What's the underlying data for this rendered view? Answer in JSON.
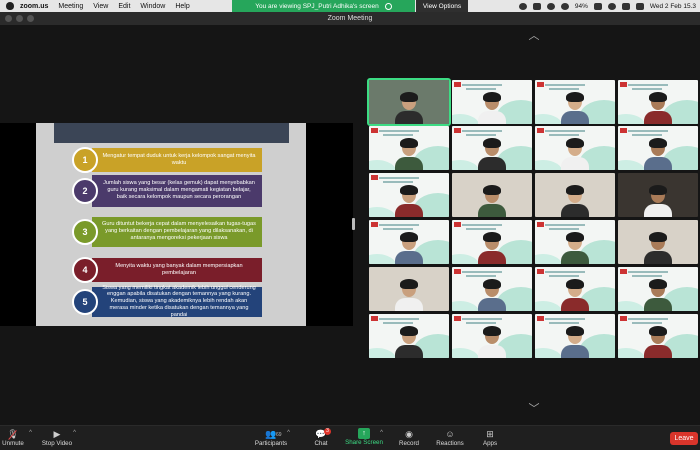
{
  "menubar": {
    "app": "zoom.us",
    "items": [
      "Meeting",
      "View",
      "Edit",
      "Window",
      "Help"
    ],
    "share_banner": "You are viewing SPJ_Putri Adhika's screen",
    "view_options": "View Options",
    "battery": "94%",
    "clock": "Wed 2 Feb  15.3"
  },
  "window": {
    "title": "Zoom Meeting"
  },
  "slide": {
    "rows": [
      {
        "num": "1",
        "text": "Mengatur tempat duduk untuk kerja kelompok sangat menyita waktu",
        "color": "#c9a227",
        "num_color": "#c9a227"
      },
      {
        "num": "2",
        "text": "Jumlah siswa yang besar (kelas gemuk) dapat menyebabkan guru kurang maksimal dalam mengamati kegiatan belajar, baik secara kelompok maupun secara perorangan",
        "color": "#4b3a6b",
        "num_color": "#4b3a6b"
      },
      {
        "num": "3",
        "text": "Guru dituntut bekerja cepat dalam menyelesaikan tugas-tugas yang berkaitan dengan pembelajaran yang dilaksanakan, di antaranya mengoreksi pekerjaan siswa",
        "color": "#7a9a2a",
        "num_color": "#7a9a2a"
      },
      {
        "num": "4",
        "text": "Menyita waktu yang banyak dalam mempersiapkan pembelajaran",
        "color": "#7a1e2a",
        "num_color": "#7a1e2a"
      },
      {
        "num": "5",
        "text": "Siswa yang memiliki tingkat akademik lebih unggul cenderung enggan apabila disatukan dengan temannya yang kurang. Kemudian, siswa yang akademiknya lebih rendah akan merasa minder ketika disatukan dengan temannya yang pandai",
        "color": "#23437a",
        "num_color": "#23437a"
      }
    ]
  },
  "toolbar": {
    "unmute": "Unmute",
    "stop_video": "Stop Video",
    "participants": "Participants",
    "participants_count": "69",
    "chat": "Chat",
    "chat_badge": "3",
    "share_screen": "Share Screen",
    "record": "Record",
    "reactions": "Reactions",
    "apps": "Apps",
    "leave": "Leave"
  },
  "icons": {
    "mic": "mic-muted-icon",
    "video": "video-camera-icon",
    "participants": "participants-icon",
    "chat": "chat-bubble-icon",
    "share": "share-screen-icon",
    "record": "record-icon",
    "reactions": "emoji-icon",
    "apps": "apps-icon"
  }
}
